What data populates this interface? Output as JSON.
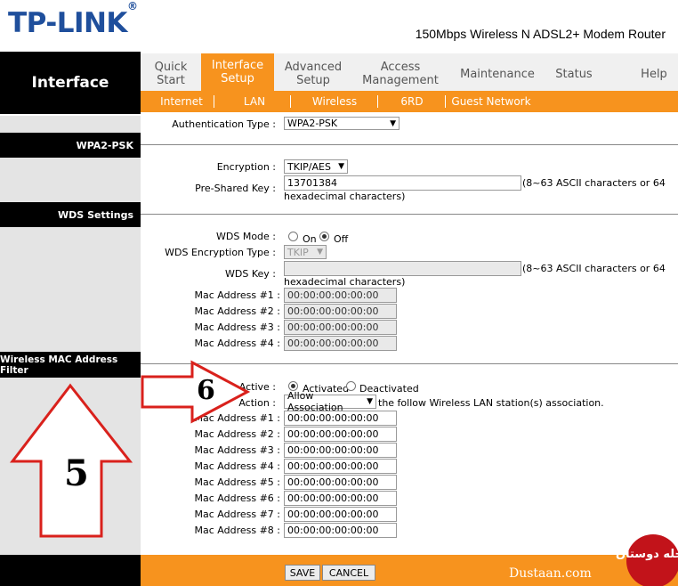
{
  "header": {
    "logo_text": "TP-LINK",
    "logo_mark": "®",
    "model": "150Mbps Wireless N ADSL2+ Modem Router"
  },
  "nav": {
    "section_title": "Interface",
    "tabs": [
      {
        "label": "Quick Start"
      },
      {
        "label": "Interface Setup",
        "active": true
      },
      {
        "label": "Advanced Setup"
      },
      {
        "label": "Access Management"
      },
      {
        "label": "Maintenance"
      },
      {
        "label": "Status"
      },
      {
        "label": "Help"
      }
    ],
    "subtabs": [
      "Internet",
      "LAN",
      "Wireless",
      "6RD",
      "Guest Network"
    ]
  },
  "colors": {
    "brand_blue": "#1f4f9c",
    "accent_orange": "#f7931e",
    "annotation_red": "#d9211c"
  },
  "form": {
    "auth_type_label": "Authentication Type :",
    "auth_type_value": "WPA2-PSK",
    "wpa": {
      "section_label": "WPA2-PSK",
      "encryption_label": "Encryption :",
      "encryption_value": "TKIP/AES",
      "psk_label": "Pre-Shared Key :",
      "psk_value": "13701384",
      "psk_hint_1": "(8~63 ASCII characters or 64",
      "psk_hint_2": "hexadecimal characters)"
    },
    "wds": {
      "section_label": "WDS Settings",
      "mode_label": "WDS Mode :",
      "mode_on": "On",
      "mode_off": "Off",
      "mode_selected": "Off",
      "enc_label": "WDS Encryption Type :",
      "enc_value": "TKIP",
      "key_label": "WDS Key :",
      "key_hint_1": "(8~63 ASCII characters or 64",
      "key_hint_2": "hexadecimal characters)",
      "macs": [
        {
          "label": "Mac Address #1 :",
          "value": "00:00:00:00:00:00"
        },
        {
          "label": "Mac Address #2 :",
          "value": "00:00:00:00:00:00"
        },
        {
          "label": "Mac Address #3 :",
          "value": "00:00:00:00:00:00"
        },
        {
          "label": "Mac Address #4 :",
          "value": "00:00:00:00:00:00"
        }
      ]
    },
    "mac_filter": {
      "section_label": "Wireless MAC Address Filter",
      "active_label": "Active :",
      "activated": "Activated",
      "deactivated": "Deactivated",
      "active_selected": "Activated",
      "action_label": "Action :",
      "action_value": "Allow Association",
      "action_suffix": "the follow Wireless LAN station(s) association.",
      "macs": [
        {
          "label": "Mac Address #1 :",
          "value": "00:00:00:00:00:00"
        },
        {
          "label": "Mac Address #2 :",
          "value": "00:00:00:00:00:00"
        },
        {
          "label": "Mac Address #3 :",
          "value": "00:00:00:00:00:00"
        },
        {
          "label": "Mac Address #4 :",
          "value": "00:00:00:00:00:00"
        },
        {
          "label": "Mac Address #5 :",
          "value": "00:00:00:00:00:00"
        },
        {
          "label": "Mac Address #6 :",
          "value": "00:00:00:00:00:00"
        },
        {
          "label": "Mac Address #7 :",
          "value": "00:00:00:00:00:00"
        },
        {
          "label": "Mac Address #8 :",
          "value": "00:00:00:00:00:00"
        }
      ]
    }
  },
  "footer": {
    "save_label": "SAVE",
    "cancel_label": "CANCEL"
  },
  "annotations": {
    "arrow_5": "5",
    "arrow_6": "6",
    "watermark": "Dustaan.com",
    "watermark_logo": "مجله دوستان"
  }
}
